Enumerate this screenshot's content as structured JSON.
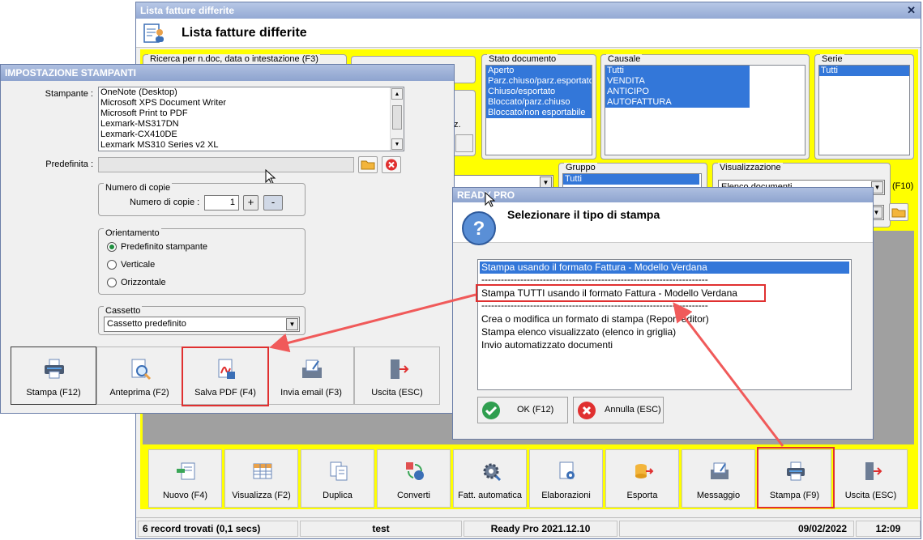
{
  "main": {
    "title": "Lista fatture differite",
    "close_glyph": "✕",
    "header_title": "Lista fatture differite",
    "search_group_label": "Ricerca per n.doc, data o intestazione (F3)",
    "partial_text": "z.",
    "stato": {
      "label": "Stato documento",
      "items": [
        "Aperto",
        "Parz.chiuso/parz.esportato",
        "Chiuso/esportato",
        "Bloccato/parz.chiuso",
        "Bloccato/non esportabile"
      ]
    },
    "causale": {
      "label": "Causale",
      "items": [
        "Tutti",
        "VENDITA",
        "ANTICIPO",
        "AUTOFATTURA"
      ]
    },
    "serie": {
      "label": "Serie",
      "items": [
        "Tutti"
      ]
    },
    "gruppo": {
      "label": "Gruppo",
      "items": [
        "Tutti"
      ]
    },
    "visualizzazione": {
      "label": "Visualizzazione",
      "value": "Elenco documenti",
      "shortcut": "(F10)"
    },
    "toolbar": [
      "Nuovo (F4)",
      "Visualizza (F2)",
      "Duplica",
      "Converti",
      "Fatt. automatica",
      "Elaborazioni",
      "Esporta",
      "Messaggio",
      "Stampa (F9)",
      "Uscita (ESC)"
    ],
    "status": {
      "records": "6 record trovati (0,1 secs)",
      "user": "test",
      "version": "Ready Pro 2021.12.10",
      "date": "09/02/2022",
      "time": "12:09"
    }
  },
  "printer": {
    "title": "IMPOSTAZIONE STAMPANTI",
    "printer_label": "Stampante :",
    "printers": [
      "OneNote (Desktop)",
      "Microsoft XPS Document Writer",
      "Microsoft Print to PDF",
      "Lexmark-MS317DN",
      "Lexmark-CX410DE",
      "Lexmark MS310 Series v2 XL"
    ],
    "default_label": "Predefinita :",
    "copies_group": "Numero di copie",
    "copies_label": "Numero di copie :",
    "copies_value": "1",
    "plus": "+",
    "minus": "-",
    "orient_group": "Orientamento",
    "orient_options": [
      "Predefinito stampante",
      "Verticale",
      "Orizzontale"
    ],
    "tray_group": "Cassetto",
    "tray_value": "Cassetto predefinito",
    "buttons": [
      "Stampa (F12)",
      "Anteprima (F2)",
      "Salva PDF (F4)",
      "Invia email (F3)",
      "Uscita (ESC)"
    ]
  },
  "ready": {
    "title": "READY PRO",
    "message": "Selezionare il tipo di stampa",
    "options": [
      "Stampa usando il formato Fattura - Modello Verdana",
      "----------------------------------------------------------------------",
      "Stampa TUTTI usando il formato Fattura - Modello Verdana",
      "----------------------------------------------------------------------",
      "Crea o modifica un formato di stampa (Report editor)",
      "Stampa elenco visualizzato (elenco in griglia)",
      "Invio automatizzato documenti"
    ],
    "ok": "OK (F12)",
    "cancel": "Annulla (ESC)"
  },
  "colors": {
    "highlight": "#e03030",
    "yellow": "#ffff00",
    "selection": "#3377d9"
  }
}
